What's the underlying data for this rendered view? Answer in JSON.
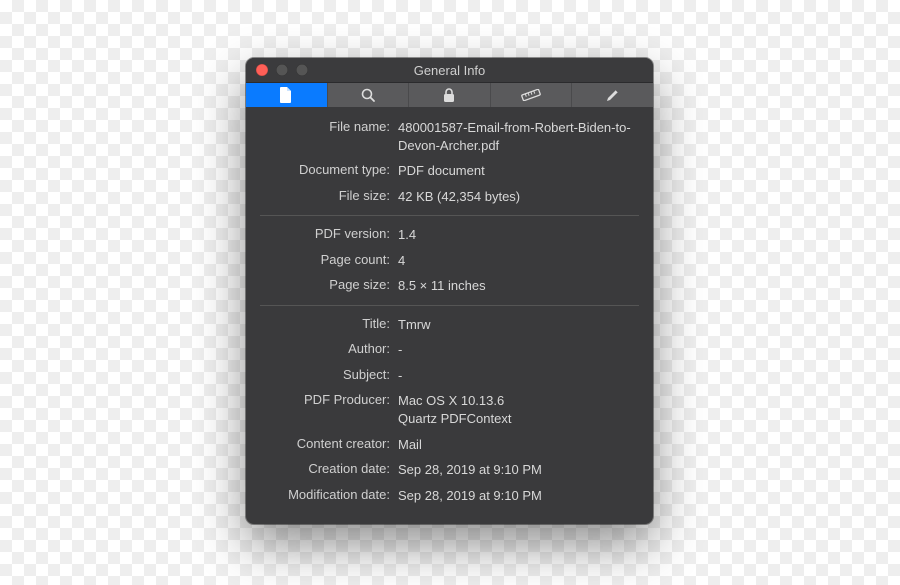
{
  "window": {
    "title": "General Info"
  },
  "tabs": [
    "file",
    "search",
    "lock",
    "ruler",
    "pencil"
  ],
  "sections": [
    [
      {
        "label": "File name:",
        "value": "480001587-Email-from-Robert-Biden-to-Devon-Archer.pdf"
      },
      {
        "label": "Document type:",
        "value": "PDF document"
      },
      {
        "label": "File size:",
        "value": "42 KB (42,354 bytes)"
      }
    ],
    [
      {
        "label": "PDF version:",
        "value": "1.4"
      },
      {
        "label": "Page count:",
        "value": "4"
      },
      {
        "label": "Page size:",
        "value": "8.5 × 11 inches"
      }
    ],
    [
      {
        "label": "Title:",
        "value": "Tmrw"
      },
      {
        "label": "Author:",
        "value": "-"
      },
      {
        "label": "Subject:",
        "value": "-"
      },
      {
        "label": "PDF Producer:",
        "value": "Mac OS X 10.13.6\nQuartz PDFContext"
      },
      {
        "label": "Content creator:",
        "value": "Mail"
      },
      {
        "label": "Creation date:",
        "value": "Sep 28, 2019 at 9:10 PM"
      },
      {
        "label": "Modification date:",
        "value": "Sep 28, 2019 at 9:10 PM"
      }
    ]
  ]
}
